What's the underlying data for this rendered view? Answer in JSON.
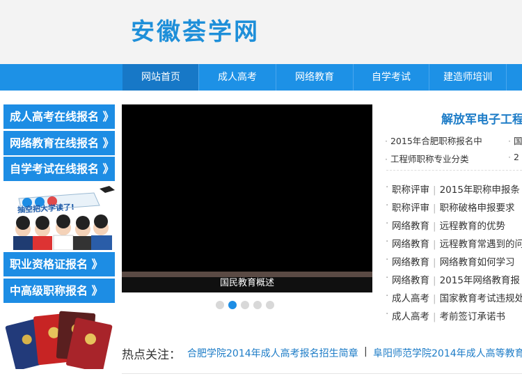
{
  "header": {
    "logo": "安徽荟学网"
  },
  "nav": {
    "items": [
      "网站首页",
      "成人高考",
      "网络教育",
      "自学考试",
      "建造师培训"
    ]
  },
  "sidebar": {
    "buttons": [
      "成人高考在线报名 》",
      "网络教育在线报名 》",
      "自学考试在线报名 》",
      "职业资格证报名 》",
      "中高级职称报名 》"
    ],
    "ad_banner_text": "抽空把大学读了!"
  },
  "video": {
    "caption": "国民教育概述"
  },
  "right": {
    "title": "解放军电子工程",
    "quick_links": [
      "2015年合肥职称报名中",
      "国",
      "工程师职称专业分类",
      "2"
    ],
    "news": [
      {
        "cat": "职称评审",
        "title": "2015年职称申报条"
      },
      {
        "cat": "职称评审",
        "title": "职称破格申报要求"
      },
      {
        "cat": "网络教育",
        "title": "远程教育的优势"
      },
      {
        "cat": "网络教育",
        "title": "远程教育常遇到的问"
      },
      {
        "cat": "网络教育",
        "title": "网络教育如何学习"
      },
      {
        "cat": "网络教育",
        "title": "2015年网络教育报"
      },
      {
        "cat": "成人高考",
        "title": "国家教育考试违规处"
      },
      {
        "cat": "成人高考",
        "title": "考前签订承诺书"
      }
    ]
  },
  "hot": {
    "label": "热点关注：",
    "links": [
      "合肥学院2014年成人高考报名招生简章",
      "阜阳师范学院2014年成人高等教育"
    ],
    "separator": "|"
  },
  "colors": {
    "brand_blue": "#1d91e6",
    "nav_active": "#1778c7",
    "link_blue": "#1d7cc7"
  }
}
